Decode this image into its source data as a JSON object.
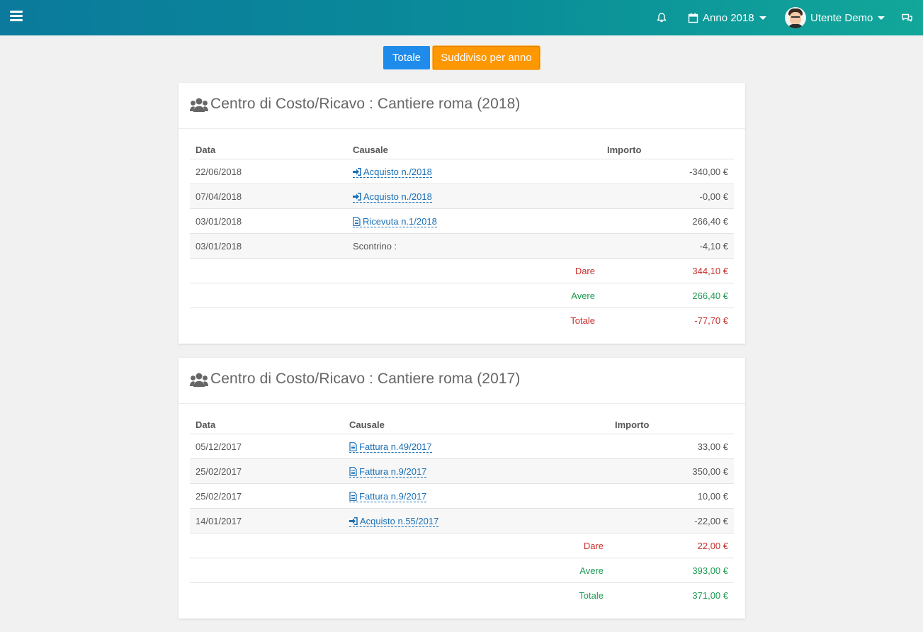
{
  "topbar": {
    "year_label": "Anno 2018",
    "user_name": "Utente Demo"
  },
  "toggle": {
    "totale_label": "Totale",
    "per_anno_label": "Suddiviso per anno"
  },
  "colors": {
    "accent_blue": "#1f8ceb",
    "accent_orange": "#ff9800",
    "dare_red": "#c9302c",
    "avere_green": "#1e9a52",
    "link_blue": "#1a6fb5"
  },
  "cards": [
    {
      "title": "Centro di Costo/Ricavo : Cantiere roma (2018)",
      "columns": {
        "date": "Data",
        "causale": "Causale",
        "importo": "Importo"
      },
      "rows": [
        {
          "date": "22/06/2018",
          "causale": "Acquisto n./2018",
          "icon": "sign-in-icon",
          "link": true,
          "amount": "-340,00 €"
        },
        {
          "date": "07/04/2018",
          "causale": "Acquisto n./2018",
          "icon": "sign-in-icon",
          "link": true,
          "amount": "-0,00 €"
        },
        {
          "date": "03/01/2018",
          "causale": "Ricevuta n.1/2018",
          "icon": "file-icon",
          "link": true,
          "amount": "266,40 €"
        },
        {
          "date": "03/01/2018",
          "causale": "Scontrino :",
          "icon": "",
          "link": false,
          "amount": "-4,10 €"
        }
      ],
      "summary": [
        {
          "label": "Dare",
          "amount": "344,10 €",
          "tone": "red"
        },
        {
          "label": "Avere",
          "amount": "266,40 €",
          "tone": "green"
        },
        {
          "label": "Totale",
          "amount": "-77,70 €",
          "tone": "red"
        }
      ]
    },
    {
      "title": "Centro di Costo/Ricavo : Cantiere roma (2017)",
      "columns": {
        "date": "Data",
        "causale": "Causale",
        "importo": "Importo"
      },
      "rows": [
        {
          "date": "05/12/2017",
          "causale": "Fattura n.49/2017",
          "icon": "file-icon",
          "link": true,
          "amount": "33,00 €"
        },
        {
          "date": "25/02/2017",
          "causale": "Fattura n.9/2017",
          "icon": "file-icon",
          "link": true,
          "amount": "350,00 €"
        },
        {
          "date": "25/02/2017",
          "causale": "Fattura n.9/2017",
          "icon": "file-icon",
          "link": true,
          "amount": "10,00 €"
        },
        {
          "date": "14/01/2017",
          "causale": "Acquisto n.55/2017",
          "icon": "sign-in-icon",
          "link": true,
          "amount": "-22,00 €"
        }
      ],
      "summary": [
        {
          "label": "Dare",
          "amount": "22,00 €",
          "tone": "red"
        },
        {
          "label": "Avere",
          "amount": "393,00 €",
          "tone": "green"
        },
        {
          "label": "Totale",
          "amount": "371,00 €",
          "tone": "green"
        }
      ]
    }
  ]
}
